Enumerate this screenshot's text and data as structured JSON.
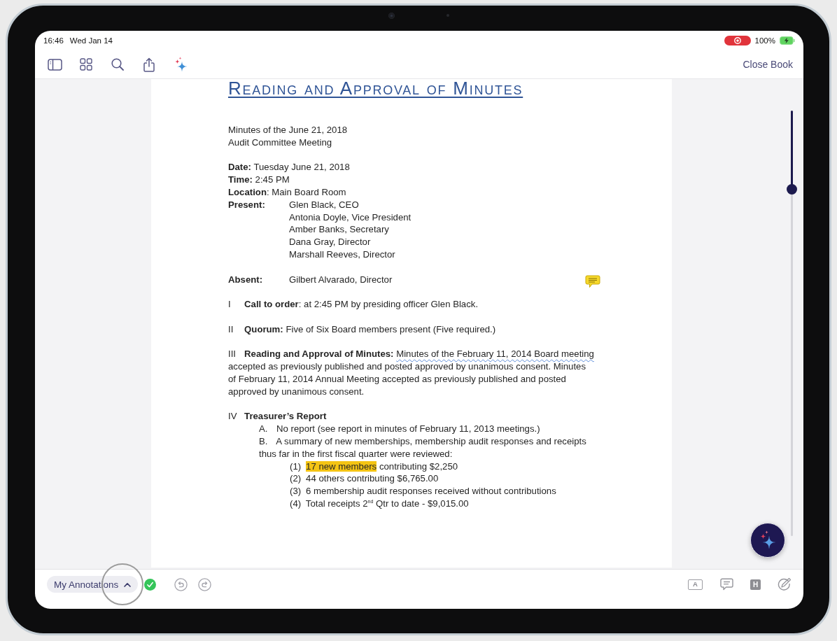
{
  "status_bar": {
    "time": "16:46",
    "date": "Wed Jan 14",
    "battery_percent": "100%"
  },
  "toolbar": {
    "tools": [
      {
        "kind": "sidebar"
      },
      {
        "kind": "grid"
      },
      {
        "kind": "search"
      },
      {
        "kind": "share"
      },
      {
        "kind": "sparkle"
      }
    ],
    "close_button": "Close Book"
  },
  "document": {
    "title": "Reading and Approval of Minutes",
    "intro": [
      "Minutes of the June 21, 2018",
      "Audit Committee Meeting"
    ],
    "details": [
      "**Date:** Tuesday June 21, 2018",
      "**Time:** 2:45 PM",
      "**Location**: Main Board Room"
    ],
    "attendance": [
      {
        "label": "Present:",
        "names": [
          "Glen Black, CEO",
          "Antonia Doyle, Vice President",
          "Amber Banks, Secretary",
          "Dana Gray, Director",
          "Marshall Reeves, Director"
        ]
      },
      {
        "label": "Absent:",
        "names": [
          "Gilbert Alvarado, Director"
        ]
      }
    ],
    "sections": [
      {
        "numeral": "I",
        "parts": [
          {
            "kind": "text",
            "text": "**Call to order**: at 2:45 PM by presiding officer Glen Black."
          }
        ]
      },
      {
        "numeral": "II",
        "parts": [
          {
            "kind": "text",
            "text": "**Quorum:** Five of Six Board members present (Five required.)"
          }
        ]
      },
      {
        "numeral": "III",
        "parts": [
          {
            "kind": "text",
            "text": "**Reading and Approval of Minutes:** "
          },
          {
            "kind": "squiggly",
            "text": "Minutes of the February 11, 2014 Board meeting"
          },
          {
            "kind": "text",
            "text": " accepted as previously published and posted approved by unanimous consent. Minutes of February 11, 2014 Annual Meeting accepted as previously published and posted approved by unanimous consent."
          }
        ]
      },
      {
        "numeral": "IV",
        "parts": [
          {
            "kind": "text",
            "text": "**Treasurer’s Report**"
          }
        ],
        "children": [
          {
            "numeral": "A.",
            "parts": [
              {
                "kind": "text",
                "text": "No report (see report in minutes of February 11, 2013 meetings.)"
              }
            ]
          },
          {
            "numeral": "B.",
            "parts": [
              {
                "kind": "text",
                "text": "A summary of new memberships, membership audit responses and receipts thus far in the first fiscal quarter were reviewed:"
              }
            ],
            "children": [
              {
                "numeral": "(1)",
                "parts": [
                  {
                    "kind": "highlight",
                    "text": "17 new members"
                  },
                  {
                    "kind": "text",
                    "text": " contributing $2,250"
                  }
                ]
              },
              {
                "numeral": "(2)",
                "parts": [
                  {
                    "kind": "text",
                    "text": "44 others contributing $6,765.00"
                  }
                ]
              },
              {
                "numeral": "(3)",
                "parts": [
                  {
                    "kind": "text",
                    "text": "6 membership audit responses received without contributions"
                  }
                ]
              },
              {
                "numeral": "(4)",
                "parts": [
                  {
                    "kind": "text",
                    "text": "Total receipts 2$^{nd}$ Qtr to date - $9,015.00"
                  }
                ]
              }
            ]
          }
        ]
      }
    ]
  },
  "bottom_bar": {
    "annotations_menu": "My Annotations",
    "tools": [
      {
        "kind": "text-box",
        "glyph": "A"
      },
      {
        "kind": "comment"
      },
      {
        "kind": "highlight",
        "glyph": "H"
      },
      {
        "kind": "eraser"
      }
    ]
  }
}
